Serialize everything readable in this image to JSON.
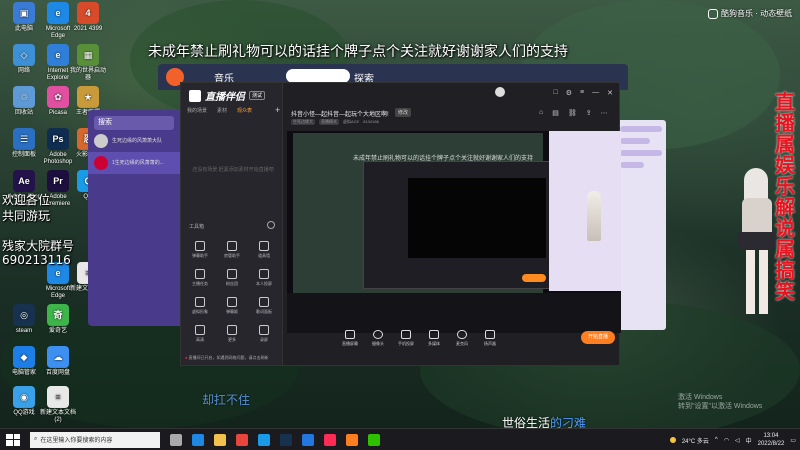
{
  "overlay": {
    "banner": "未成年禁止刷礼物可以的话挂个牌子点个关注就好谢谢家人们的支持",
    "welcome_line1": "欢迎各位",
    "welcome_line2": "共同游玩",
    "group_label": "残家大院群号",
    "group_number": "690213116",
    "vertical_text": "直播属娱乐解说属搞笑",
    "brand_top": "酷狗音乐 · 动态壁纸",
    "watermark_line1": "激活 Windows",
    "watermark_line2": "转到\"设置\"以激活 Windows"
  },
  "lyrics": {
    "line1": "却扛不住",
    "line2_white": "世俗生活",
    "line2_blue": "的刁难"
  },
  "desktop_icons": [
    {
      "label": "此电脑",
      "color": "#3a7bd5",
      "glyph": "▣"
    },
    {
      "label": "Microsoft Edge",
      "color": "#1e88e5",
      "glyph": "e"
    },
    {
      "label": "2021 4399",
      "color": "#d84b2a",
      "glyph": "4"
    },
    {
      "label": "网络",
      "color": "#3d8fd6",
      "glyph": "◇"
    },
    {
      "label": "Internet Explorer",
      "color": "#2f7fd8",
      "glyph": "e"
    },
    {
      "label": "我的世界启动器",
      "color": "#5a8f3a",
      "glyph": "▦"
    },
    {
      "label": "回收站",
      "color": "#5d9ad6",
      "glyph": "♲"
    },
    {
      "label": "Picasa",
      "color": "#e04fa0",
      "glyph": "✿"
    },
    {
      "label": "王者荣耀",
      "color": "#c89a3a",
      "glyph": "★"
    },
    {
      "label": "控制面板",
      "color": "#2a6fc2",
      "glyph": "☰"
    },
    {
      "label": "Adobe Photoshop",
      "color": "#0f2d50",
      "glyph": "Ps"
    },
    {
      "label": "火影忍者",
      "color": "#d4682e",
      "glyph": "忍"
    },
    {
      "label": "Adobe After Effects",
      "color": "#24124a",
      "glyph": "Ae"
    },
    {
      "label": "Adobe Premiere",
      "color": "#1c0f3e",
      "glyph": "Pr"
    },
    {
      "label": "QQ",
      "color": "#1a9be8",
      "glyph": "Q"
    },
    {
      "label": "酷狗音乐",
      "color": "#2378e0",
      "glyph": "K"
    },
    {
      "label": "Microsoft Edge",
      "color": "#1e88e5",
      "glyph": "e"
    },
    {
      "label": "新建文本文档",
      "color": "#e8e8e8",
      "glyph": "≡"
    },
    {
      "label": "steam",
      "color": "#17324f",
      "glyph": "◎"
    },
    {
      "label": "爱奇艺",
      "color": "#3db54a",
      "glyph": "奇"
    },
    {
      "label": "电脑管家",
      "color": "#1d7ee8",
      "glyph": "◆"
    },
    {
      "label": "百度网盘",
      "color": "#3d8ff0",
      "glyph": "☁"
    },
    {
      "label": "QQ游戏",
      "color": "#3aa0e8",
      "glyph": "◉"
    },
    {
      "label": "新建文本文档(2)",
      "color": "#e8e8e8",
      "glyph": "≡"
    }
  ],
  "music_app": {
    "nav": [
      "音乐",
      "听书",
      "探索"
    ]
  },
  "purple_app": {
    "header": "搜索",
    "rows": [
      {
        "name": "生死边缘的风萧萧大队"
      },
      {
        "name": "1生死边缘的风萧萧的..."
      }
    ]
  },
  "streamer": {
    "logo": "直播伴侣",
    "logo_tag": "测试",
    "tabs": [
      "我的场景",
      "素材",
      "观众表"
    ],
    "empty_text": "还没有场景 赶紧添加素材开始直播吧",
    "tools_header": "工具箱",
    "tools": [
      "弹幕助手",
      "房管助手",
      "道具墙",
      "主播任务",
      "粉丝团",
      "本人投屏",
      "虚拟形象",
      "弹幕姬",
      "歌词面板",
      "高清",
      "更多",
      "录屏"
    ],
    "title": "抖音小怪—起抖音—起玩个大地区啊!",
    "title_badge": "修改",
    "meta": [
      "生死边缘大",
      "直播模式",
      "虚拟ACE",
      "8134186"
    ],
    "window_controls": [
      "□",
      "⚙",
      "≡",
      "—",
      "✕"
    ],
    "bottom_buttons": [
      "直播屏幕",
      "摄像头",
      "手机投屏",
      "多媒体",
      "麦克风",
      "扬声器"
    ],
    "start_button": "开始直播",
    "record_label": "录制",
    "status_text": "直播间已开启，如遇到网络问题，请点击刷新",
    "nested_banner": "未成年禁止刷礼物可以的话挂个牌子点个关注就好谢谢家人们的支持"
  },
  "taskbar": {
    "search_placeholder": "在这里输入你要搜索的内容",
    "weather": "24°C 多云",
    "time": "13:04",
    "date": "2022/8/22",
    "apps": [
      {
        "name": "task-view",
        "color": "#aaaaaa"
      },
      {
        "name": "edge",
        "color": "#1e88e5"
      },
      {
        "name": "explorer",
        "color": "#f2c14e"
      },
      {
        "name": "chrome",
        "color": "#e8453c"
      },
      {
        "name": "qq",
        "color": "#1a9be8"
      },
      {
        "name": "steam",
        "color": "#17324f"
      },
      {
        "name": "kugou",
        "color": "#2378e0"
      },
      {
        "name": "douyin",
        "color": "#fe2c55"
      },
      {
        "name": "live-companion",
        "color": "#ff7e1f"
      },
      {
        "name": "wechat",
        "color": "#2dc100"
      }
    ]
  }
}
